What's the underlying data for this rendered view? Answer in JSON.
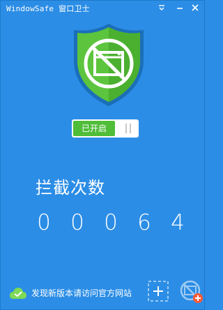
{
  "window": {
    "title": "WindowSafe 窗口卫士",
    "menu_icon": "menu-icon",
    "minimize_icon": "minimize-icon",
    "close_icon": "close-icon"
  },
  "shield": {
    "icon": "blocked-window-icon",
    "colors": {
      "shield_green": "#5cc43d",
      "shield_rim": "#1b6fb8"
    }
  },
  "toggle": {
    "state_label": "已开启",
    "on": true
  },
  "counter": {
    "label": "拦截次数",
    "digits": [
      "0",
      "0",
      "0",
      "6",
      "4"
    ]
  },
  "footer": {
    "update_text": "发现新版本请访问官方网站",
    "cloud_icon": "cloud-check-icon",
    "add_icon": "add-icon",
    "capture_icon": "capture-window-icon"
  },
  "colors": {
    "background": "#2b8de6",
    "accent_green": "#4fbd38",
    "badge_red": "#ff5a36"
  }
}
